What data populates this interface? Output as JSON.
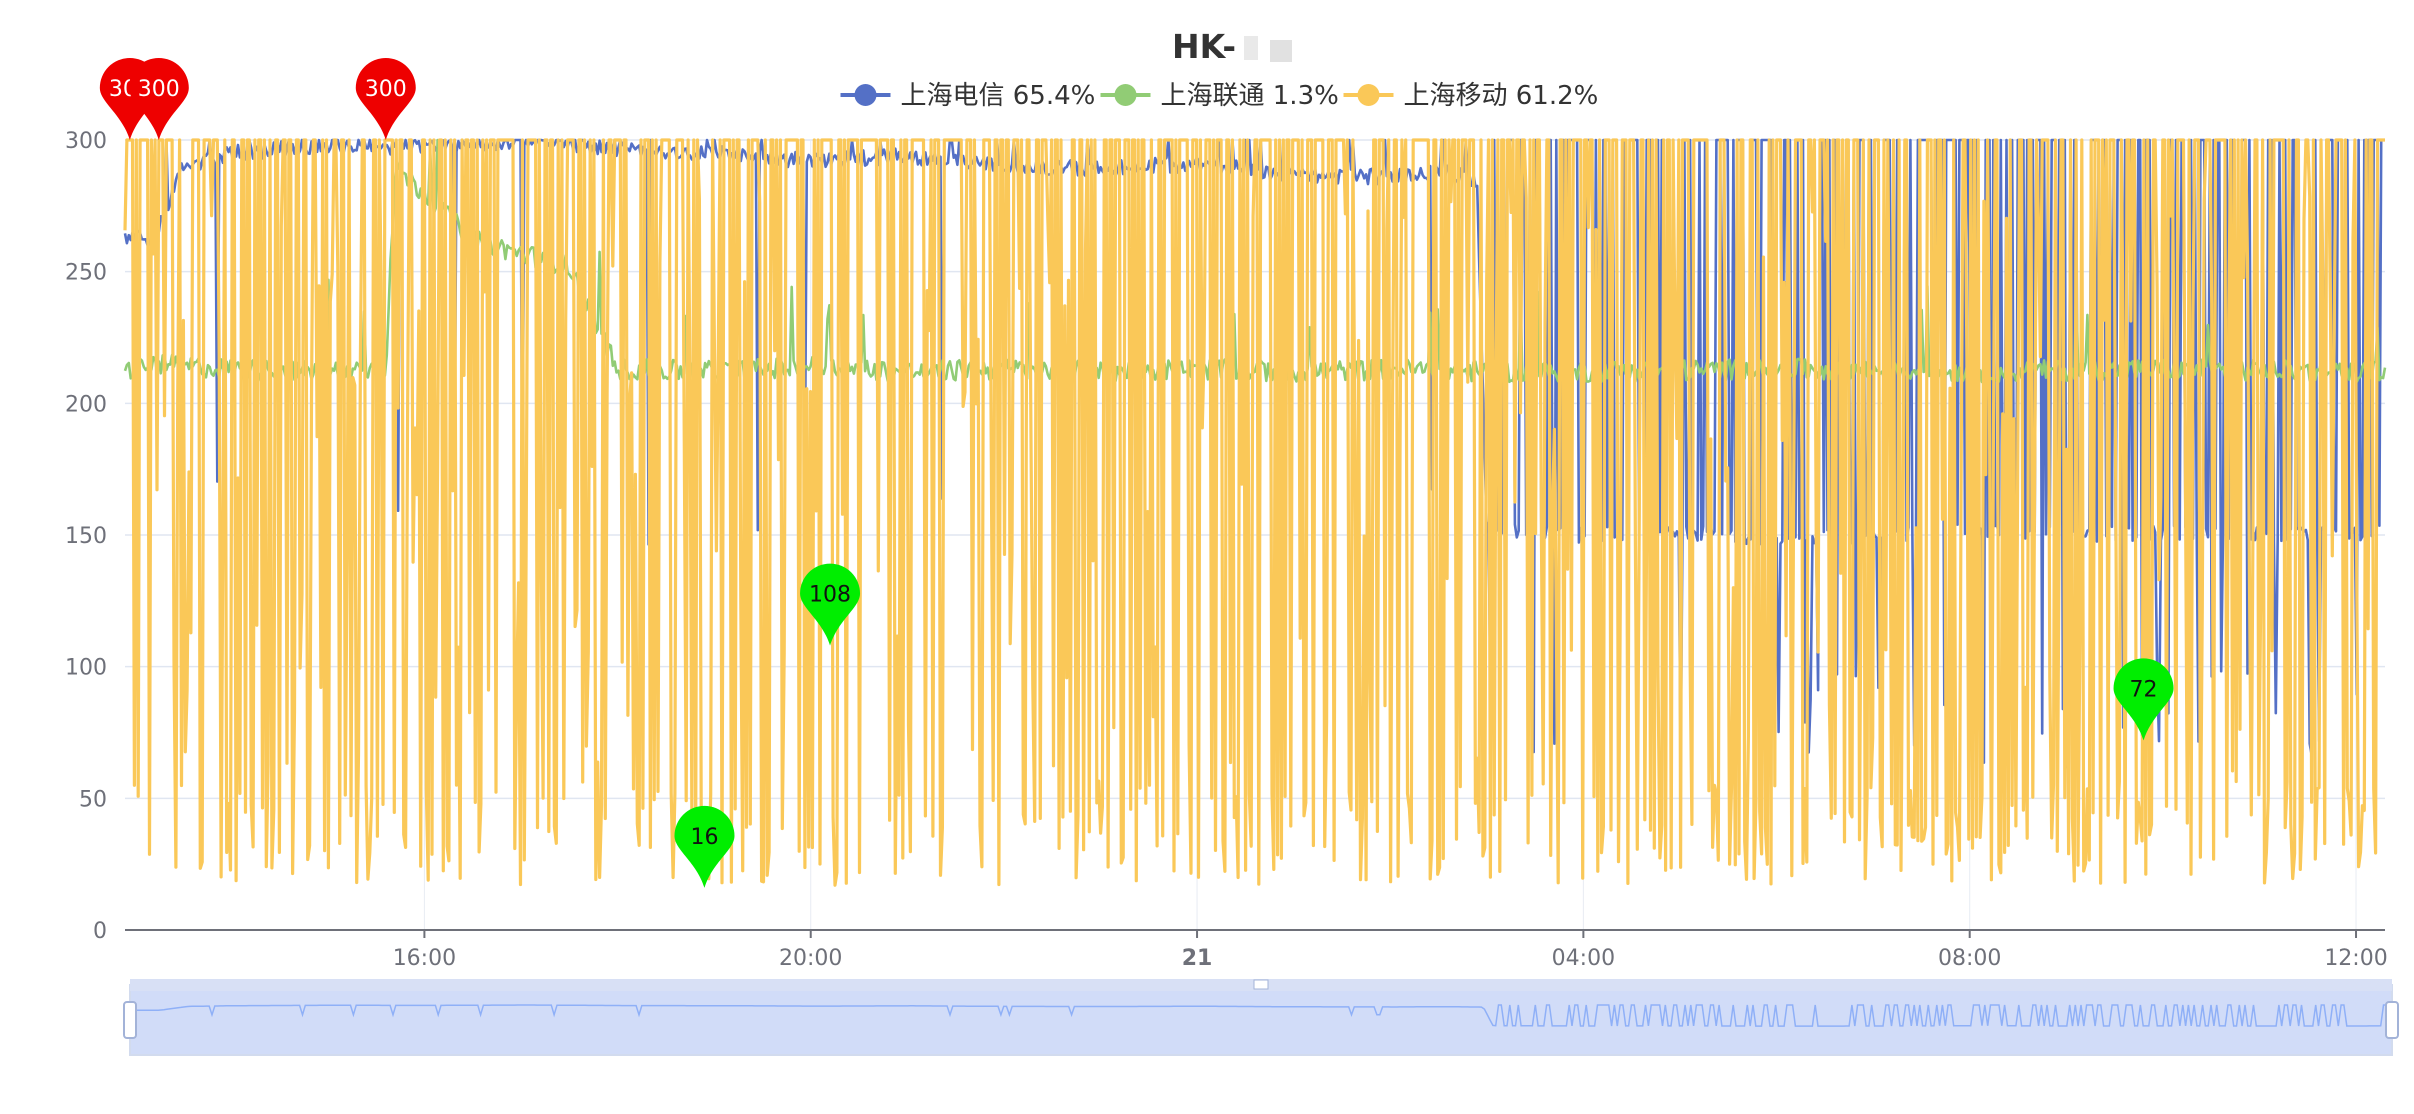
{
  "chart_data": {
    "type": "line",
    "title": "HK-",
    "ylim": [
      0,
      300
    ],
    "y_ticks": [
      0,
      50,
      100,
      150,
      200,
      250,
      300
    ],
    "x_range_hours": [
      12.9,
      36.3
    ],
    "x_ticks": [
      {
        "hour": 16,
        "label": "16:00",
        "bold": false
      },
      {
        "hour": 20,
        "label": "20:00",
        "bold": false
      },
      {
        "hour": 24,
        "label": "21",
        "bold": true
      },
      {
        "hour": 28,
        "label": "04:00",
        "bold": false
      },
      {
        "hour": 32,
        "label": "08:00",
        "bold": false
      },
      {
        "hour": 36,
        "label": "12:00",
        "bold": false
      }
    ],
    "grid": true,
    "legend_position": "top-center",
    "series": [
      {
        "name": "上海电信",
        "legend_label": "上海电信 65.4%",
        "color": "#5470c6",
        "base_points": [
          [
            12.9,
            263
          ],
          [
            13.2,
            262
          ],
          [
            13.5,
            290
          ],
          [
            14.0,
            295
          ],
          [
            15.0,
            298
          ],
          [
            16.0,
            297
          ],
          [
            17.0,
            300
          ],
          [
            18.0,
            296
          ],
          [
            19.0,
            295
          ],
          [
            20.0,
            292
          ],
          [
            21.0,
            294
          ],
          [
            22.0,
            290
          ],
          [
            23.0,
            289
          ],
          [
            24.0,
            291
          ],
          [
            25.0,
            287
          ],
          [
            26.0,
            286
          ],
          [
            26.5,
            288
          ],
          [
            26.9,
            285
          ],
          [
            27.0,
            152
          ],
          [
            28.0,
            150
          ],
          [
            29.0,
            151
          ],
          [
            30.0,
            149
          ],
          [
            31.0,
            150
          ],
          [
            32.0,
            152
          ],
          [
            33.0,
            150
          ],
          [
            34.0,
            151
          ],
          [
            35.0,
            150
          ],
          [
            36.0,
            150
          ],
          [
            36.3,
            152
          ]
        ],
        "markers": []
      },
      {
        "name": "上海联通",
        "legend_label": "上海联通 1.3%",
        "color": "#91cc75",
        "base_points": [
          [
            12.9,
            212
          ],
          [
            13.2,
            215
          ],
          [
            14.0,
            213
          ],
          [
            15.0,
            212
          ],
          [
            15.6,
            214
          ],
          [
            15.7,
            290
          ],
          [
            16.5,
            262
          ],
          [
            17.5,
            252
          ],
          [
            18.0,
            213
          ],
          [
            19.0,
            212
          ],
          [
            20.0,
            214
          ],
          [
            21.0,
            212
          ],
          [
            22.0,
            213
          ],
          [
            23.0,
            212
          ],
          [
            24.0,
            213
          ],
          [
            25.0,
            212
          ],
          [
            26.0,
            213
          ],
          [
            27.0,
            212
          ],
          [
            28.0,
            212
          ],
          [
            30.0,
            213
          ],
          [
            32.0,
            212
          ],
          [
            34.0,
            213
          ],
          [
            36.0,
            212
          ],
          [
            36.3,
            212
          ]
        ],
        "markers": [
          {
            "label": "300",
            "hour": 15.6,
            "value": 300,
            "color": "#ee0000"
          },
          {
            "label": "16",
            "hour": 18.9,
            "value": 16,
            "color": "#00ee00"
          },
          {
            "label": "108",
            "hour": 20.2,
            "value": 108,
            "color": "#00ee00"
          }
        ]
      },
      {
        "name": "上海移动",
        "legend_label": "上海移动 61.2%",
        "color": "#fac858",
        "base_points": [
          [
            12.9,
            300
          ],
          [
            36.3,
            300
          ]
        ],
        "markers": [
          {
            "label": "300",
            "hour": 12.95,
            "value": 300,
            "color": "#ee0000"
          },
          {
            "label": "300",
            "hour": 13.25,
            "value": 300,
            "color": "#ee0000"
          },
          {
            "label": "72",
            "hour": 33.8,
            "value": 72,
            "color": "#00ee00"
          }
        ]
      }
    ],
    "data_zoom": {
      "start_hour": 12.9,
      "end_hour": 36.3
    }
  }
}
